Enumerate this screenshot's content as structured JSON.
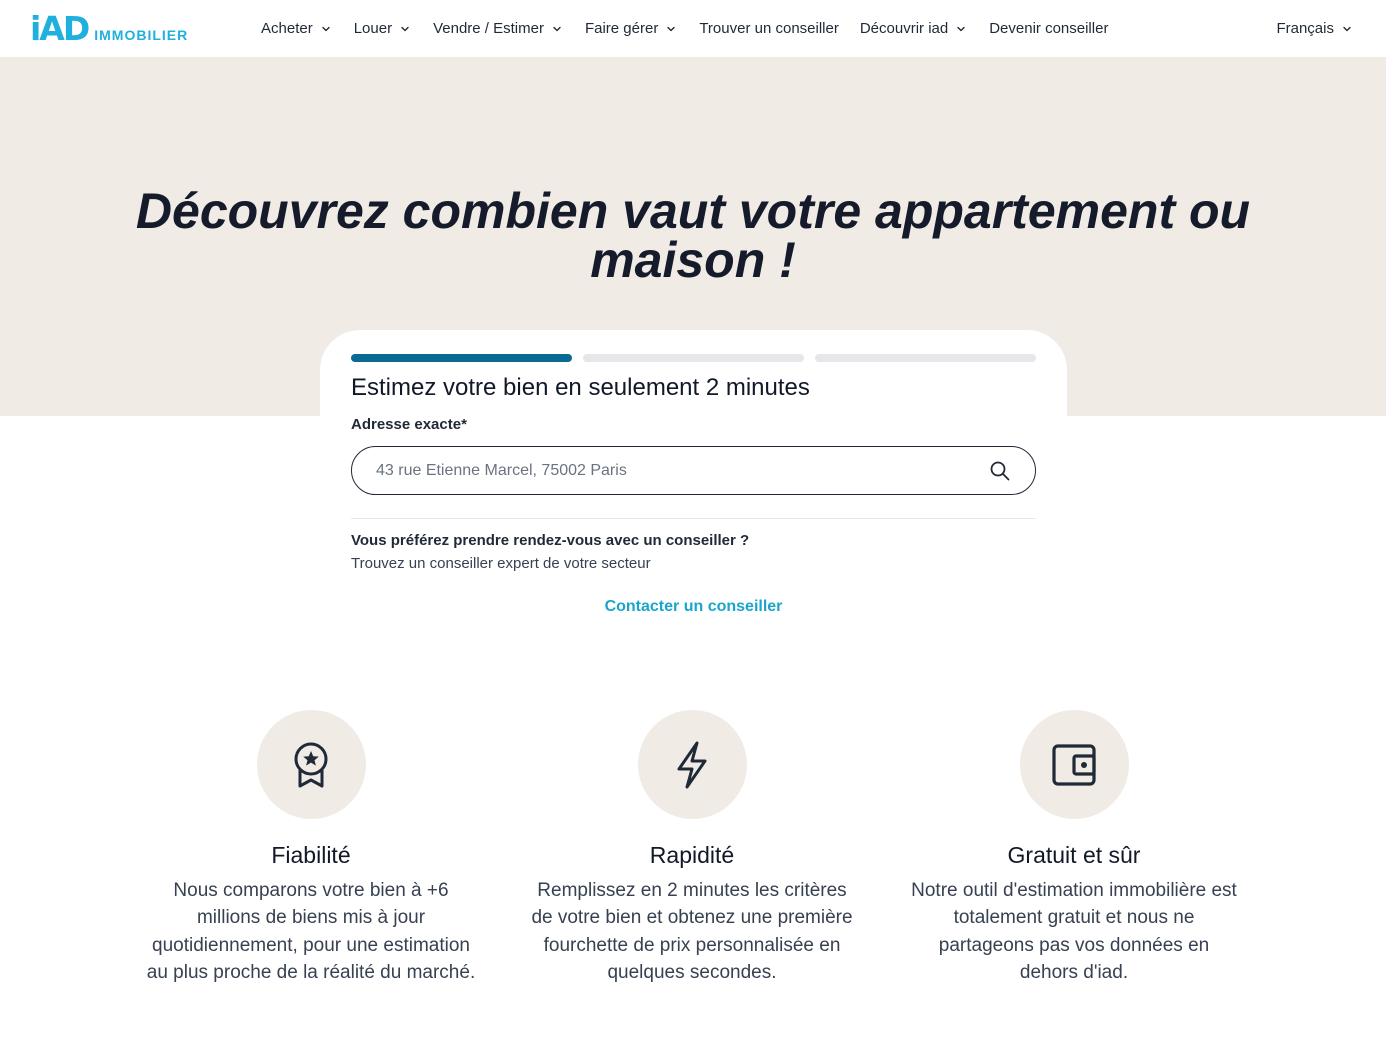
{
  "header": {
    "logo_mark": "iAD",
    "logo_text": "IMMOBILIER",
    "nav": [
      {
        "label": "Acheter",
        "dropdown": true
      },
      {
        "label": "Louer",
        "dropdown": true
      },
      {
        "label": "Vendre / Estimer",
        "dropdown": true
      },
      {
        "label": "Faire gérer",
        "dropdown": true
      },
      {
        "label": "Trouver un conseiller",
        "dropdown": false
      },
      {
        "label": "Découvrir iad",
        "dropdown": true
      },
      {
        "label": "Devenir conseiller",
        "dropdown": false
      }
    ],
    "language": "Français"
  },
  "hero": {
    "title_line1": "Découvrez combien vaut votre appartement ou",
    "title_line2": "maison !"
  },
  "card": {
    "progress": {
      "steps": 3,
      "current": 1
    },
    "title": "Estimez votre bien en seulement 2 minutes",
    "address_label": "Adresse exacte*",
    "address_placeholder": "43 rue Etienne Marcel, 75002 Paris",
    "address_value": "",
    "rdv_title": "Vous préférez prendre rendez-vous avec un conseiller ?",
    "rdv_subtitle": "Trouvez un conseiller expert de votre secteur",
    "contact_link": "Contacter un conseiller"
  },
  "features": [
    {
      "icon": "award-icon",
      "title": "Fiabilité",
      "text": "Nous comparons votre bien à +6 millions de biens mis à jour quotidiennement, pour une estimation au plus proche de la réalité du marché."
    },
    {
      "icon": "lightning-icon",
      "title": "Rapidité",
      "text": "Remplissez en 2 minutes les critères de votre bien et obtenez une première fourchette de prix personnalisée en quelques secondes."
    },
    {
      "icon": "wallet-icon",
      "title": "Gratuit et sûr",
      "text": "Notre outil d'estimation immobilière est totalement gratuit et nous ne partageons pas vos données en dehors d'iad."
    }
  ],
  "colors": {
    "brand": "#1fb0dd",
    "hero_bg": "#f0ebe5",
    "progress_active": "#0b6a94",
    "progress_inactive": "#e5e7eb",
    "link": "#1aa6cc",
    "text_dark": "#111827"
  }
}
